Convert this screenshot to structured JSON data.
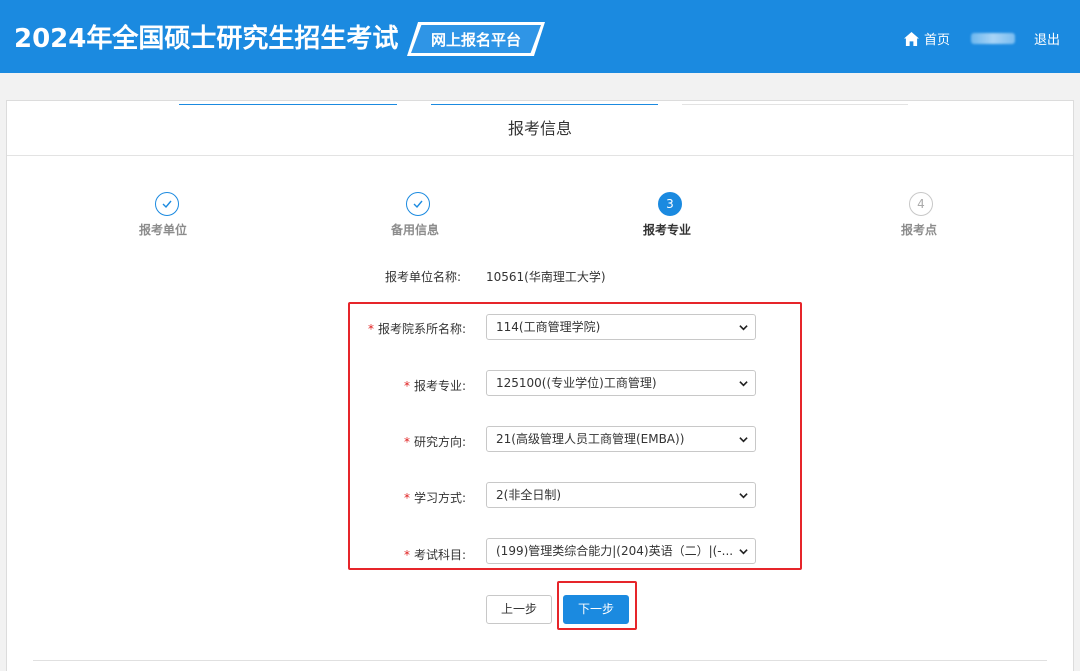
{
  "header": {
    "title": "2024年全国硕士研究生招生考试",
    "platform": "网上报名平台",
    "home_label": "首页",
    "logout_label": "退出"
  },
  "page": {
    "section_title": "报考信息"
  },
  "steps": [
    {
      "label": "报考单位",
      "state": "done",
      "marker": "✓"
    },
    {
      "label": "备用信息",
      "state": "done",
      "marker": "✓"
    },
    {
      "label": "报考专业",
      "state": "active",
      "marker": "3"
    },
    {
      "label": "报考点",
      "state": "todo",
      "marker": "4"
    }
  ],
  "unit": {
    "label": "报考单位名称:",
    "value": "10561(华南理工大学)"
  },
  "form": {
    "required_mark": "*",
    "fields": [
      {
        "label": "报考院系所名称:",
        "value": "114(工商管理学院)"
      },
      {
        "label": "报考专业:",
        "value": "125100((专业学位)工商管理)"
      },
      {
        "label": "研究方向:",
        "value": "21(高级管理人员工商管理(EMBA))"
      },
      {
        "label": "学习方式:",
        "value": "2(非全日制)"
      },
      {
        "label": "考试科目:",
        "value": "(199)管理类综合能力|(204)英语（二）|(-..."
      }
    ]
  },
  "buttons": {
    "prev_label": "上一步",
    "next_label": "下一步"
  },
  "colors": {
    "header_bg": "#1b8ae0",
    "accent": "#1b8ae0",
    "highlight_box": "#e6252a",
    "required": "#e02020"
  },
  "icons": {
    "home": "home-icon",
    "check": "check-icon",
    "dropdown": "chevron-down-icon"
  }
}
